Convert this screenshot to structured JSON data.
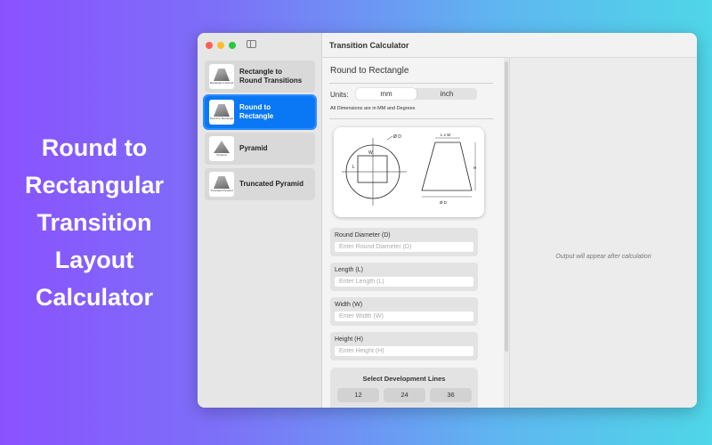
{
  "promo": {
    "lines": [
      "Round to",
      "Rectangular",
      "Transition",
      "Layout",
      "Calculator"
    ]
  },
  "sidebar": {
    "items": [
      {
        "label": "Rectangle to\nRound Transitions",
        "thumb_caption": "Rectangle to Round",
        "icon": "frustum-icon",
        "active": false
      },
      {
        "label": "Round to\nRectangle",
        "thumb_caption": "Round to Rectangle",
        "icon": "frustum-icon",
        "active": true
      },
      {
        "label": "Pyramid",
        "thumb_caption": "Pyramid",
        "icon": "pyramid-icon",
        "active": false
      },
      {
        "label": "Truncated Pyramid",
        "thumb_caption": "Truncated Pyramid",
        "icon": "frustum-icon",
        "active": false
      }
    ]
  },
  "window": {
    "title": "Transition Calculator"
  },
  "form": {
    "title": "Round to Rectangle",
    "units_label": "Units:",
    "units": {
      "mm": "mm",
      "inch": "inch",
      "selected": "mm"
    },
    "dims_note": "All Dimensions are in MM and Degrees",
    "diagram": {
      "d_label": "Ø D",
      "l_label": "L",
      "w_label": "W",
      "lxw_label": "L x W",
      "h_label": "H"
    },
    "fields": [
      {
        "label": "Round Diameter (D)",
        "placeholder": "Enter Round Diameter (D)"
      },
      {
        "label": "Length (L)",
        "placeholder": "Enter Length (L)"
      },
      {
        "label": "Width (W)",
        "placeholder": "Enter Width (W)"
      },
      {
        "label": "Height (H)",
        "placeholder": "Enter Height (H)"
      }
    ],
    "dev_lines": {
      "title": "Select Development Lines",
      "options": [
        "12",
        "24",
        "36"
      ]
    }
  },
  "output": {
    "message": "Output will appear after calculation"
  },
  "colors": {
    "accent": "#0a78f5",
    "traffic_red": "#fe5f57",
    "traffic_yellow": "#febc2e",
    "traffic_green": "#28c840"
  }
}
